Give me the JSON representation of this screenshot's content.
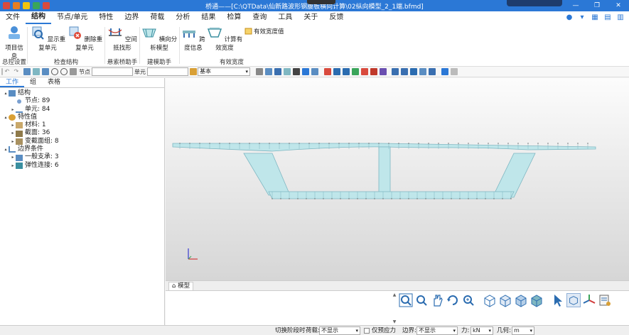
{
  "window": {
    "title": "桥通——[C:\\QTData\\仙新路波形钢腹板横向计算\\02纵向模型_2_1端.bfmd]",
    "controls": [
      "—",
      "❐",
      "✕"
    ]
  },
  "menu": {
    "tabs": [
      "文件",
      "结构",
      "节点/单元",
      "特性",
      "边界",
      "荷载",
      "分析",
      "结果",
      "检算",
      "查询",
      "工具",
      "关于",
      "反馈"
    ],
    "active": "结构"
  },
  "ribbon": {
    "buttons": {
      "project_info": "项目信息",
      "show_dup": "显示重复单元",
      "del_dup": "删除重复单元",
      "spatial_form": "空间抵找形",
      "lateral_model": "横向分析模型",
      "span_info": "跨度信息",
      "calc_eff_width": "计算有效宽度",
      "eff_width_value": "有效宽度值"
    },
    "groups": {
      "control": "总控设置",
      "check": "检查结构",
      "cable": "悬索桥助手",
      "modeling": "建模助手",
      "eff_width": "有效宽度"
    }
  },
  "toolbar": {
    "node_label": "节点",
    "elem_label": "单元",
    "node_value": "",
    "elem_value": "",
    "view_select": "基本"
  },
  "left_panel": {
    "tabs": [
      "工作",
      "组",
      "表格"
    ],
    "active_tab": "工作",
    "tree": [
      {
        "label": "结构",
        "level": 0,
        "toggle": "▴"
      },
      {
        "label": "节点: 89",
        "level": 1,
        "toggle": ""
      },
      {
        "label": "单元: 84",
        "level": 1,
        "toggle": "▸"
      },
      {
        "label": "特性值",
        "level": 0,
        "toggle": "▴"
      },
      {
        "label": "材料: 1",
        "level": 1,
        "toggle": "▸"
      },
      {
        "label": "截面: 36",
        "level": 1,
        "toggle": "▸"
      },
      {
        "label": "变截面组: 8",
        "level": 1,
        "toggle": "▸"
      },
      {
        "label": "边界条件",
        "level": 0,
        "toggle": "▴"
      },
      {
        "label": "一般支承: 3",
        "level": 1,
        "toggle": "▸"
      },
      {
        "label": "弹性连接: 6",
        "level": 1,
        "toggle": "▸"
      }
    ]
  },
  "viewport": {
    "beam_color": "#bfe6ea",
    "edge_color": "#7fb7c2"
  },
  "bottom": {
    "tab": "模型"
  },
  "statusbar": {
    "switch_stage": "切换阶段时",
    "load_label": "荷载:",
    "load_value": "不显示",
    "prestress_only": "仅预应力",
    "boundary_label": "边界:",
    "boundary_value": "不显示",
    "force_label": "力:",
    "force_value": "kN",
    "geom_label": "几何:",
    "geom_value": "m"
  }
}
